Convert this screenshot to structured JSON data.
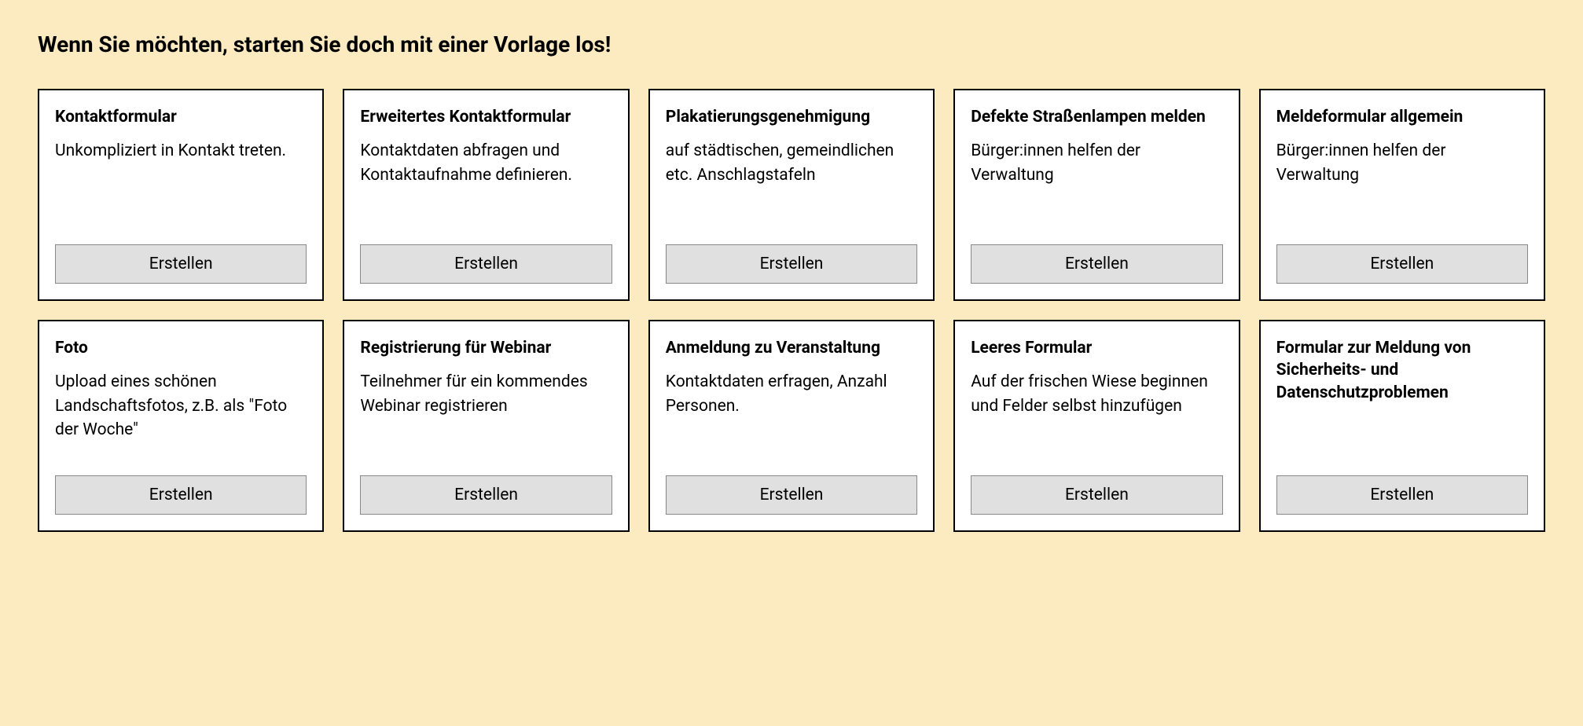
{
  "heading": "Wenn Sie möchten, starten Sie doch mit einer Vorlage los!",
  "button_label": "Erstellen",
  "templates": [
    {
      "title": "Kontaktformular",
      "description": "Unkompliziert in Kontakt treten."
    },
    {
      "title": "Erweitertes Kontaktformular",
      "description": "Kontaktdaten abfragen und Kontaktaufnahme definieren."
    },
    {
      "title": "Plakatierungsgeneh­migung",
      "description": "auf städtischen, ge­meindlichen etc. Anschlagstafeln"
    },
    {
      "title": "Defekte Straßenlam­pen melden",
      "description": "Bürger:innen helfen der Verwaltung"
    },
    {
      "title": "Meldeformular allgemein",
      "description": "Bürger:innen helfen der Verwaltung"
    },
    {
      "title": "Foto",
      "description": "Upload eines schönen Landschaftsfotos, z.B. als \"Foto der Woche\""
    },
    {
      "title": "Registrierung für Webinar",
      "description": "Teilnehmer für ein kom­mendes Webinar registrieren"
    },
    {
      "title": "Anmeldung zu Veranstaltung",
      "description": "Kontaktdaten erfragen, Anzahl Personen."
    },
    {
      "title": "Leeres Formular",
      "description": "Auf der frischen Wiese beginnen und Felder selbst hinzufügen"
    },
    {
      "title": "Formular zur Meldung von Sicherheits- und Datenschutzproble­men",
      "description": ""
    }
  ]
}
